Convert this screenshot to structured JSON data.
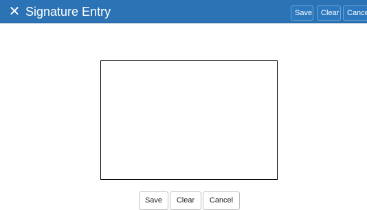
{
  "dialog": {
    "title": "Signature Entry",
    "close_icon": "close-x-icon",
    "header_color": "#2b73b5"
  },
  "header_buttons": {
    "save": "Save",
    "clear": "Clear",
    "cancel": "Cancel"
  },
  "footer_buttons": {
    "save": "Save",
    "clear": "Clear",
    "cancel": "Cancel"
  }
}
